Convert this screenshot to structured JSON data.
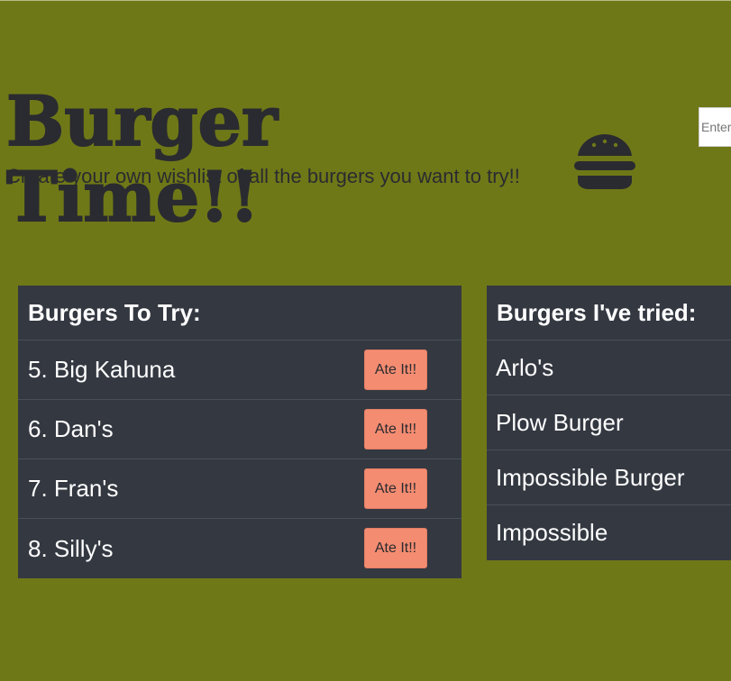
{
  "header": {
    "title": "Burger Time!!",
    "subtitle": "Create your own wishlist of all the burgers you want to try!!",
    "icon": "burger-icon"
  },
  "search": {
    "placeholder": "Enter a burger"
  },
  "to_try": {
    "heading": "Burgers To Try:",
    "button_label": "Ate It!!",
    "items": [
      {
        "label": "5. Big Kahuna"
      },
      {
        "label": "6. Dan's"
      },
      {
        "label": "7. Fran's"
      },
      {
        "label": "8. Silly's"
      }
    ]
  },
  "tried": {
    "heading": "Burgers I've tried:",
    "items": [
      {
        "label": "Arlo's"
      },
      {
        "label": "Plow Burger"
      },
      {
        "label": "Impossible Burger"
      },
      {
        "label": "Impossible"
      }
    ]
  },
  "colors": {
    "background": "#6f7817",
    "panel": "#343841",
    "button": "#f48c71",
    "text_dark": "#2a2b30"
  }
}
